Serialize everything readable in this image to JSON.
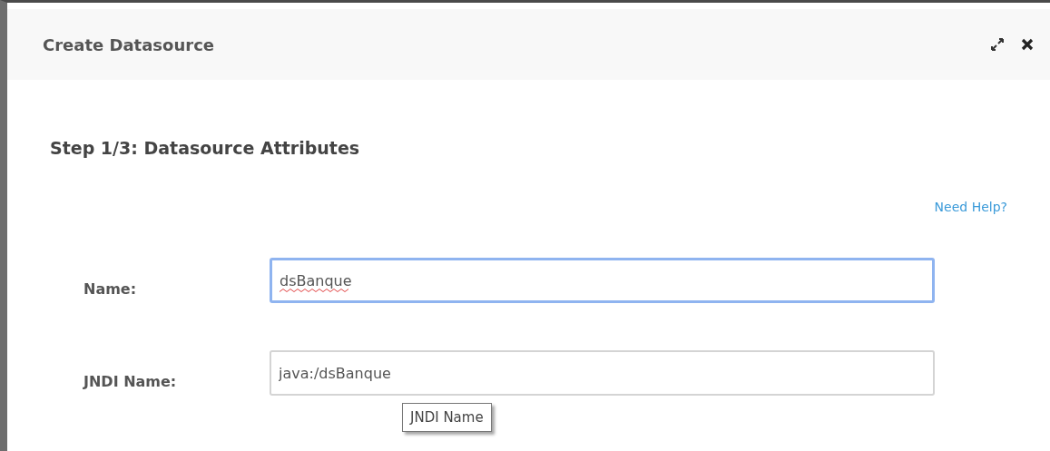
{
  "dialog": {
    "title": "Create Datasource"
  },
  "step": {
    "heading": "Step 1/3: Datasource Attributes",
    "help_link": "Need Help?"
  },
  "fields": [
    {
      "label": "Name:",
      "value": "dsBanque",
      "focused": true,
      "spellcheck_error": true
    },
    {
      "label": "JNDI Name:",
      "value": "java:/dsBanque",
      "focused": false,
      "spellcheck_error": false
    }
  ],
  "tooltip": {
    "text": "JNDI Name"
  }
}
